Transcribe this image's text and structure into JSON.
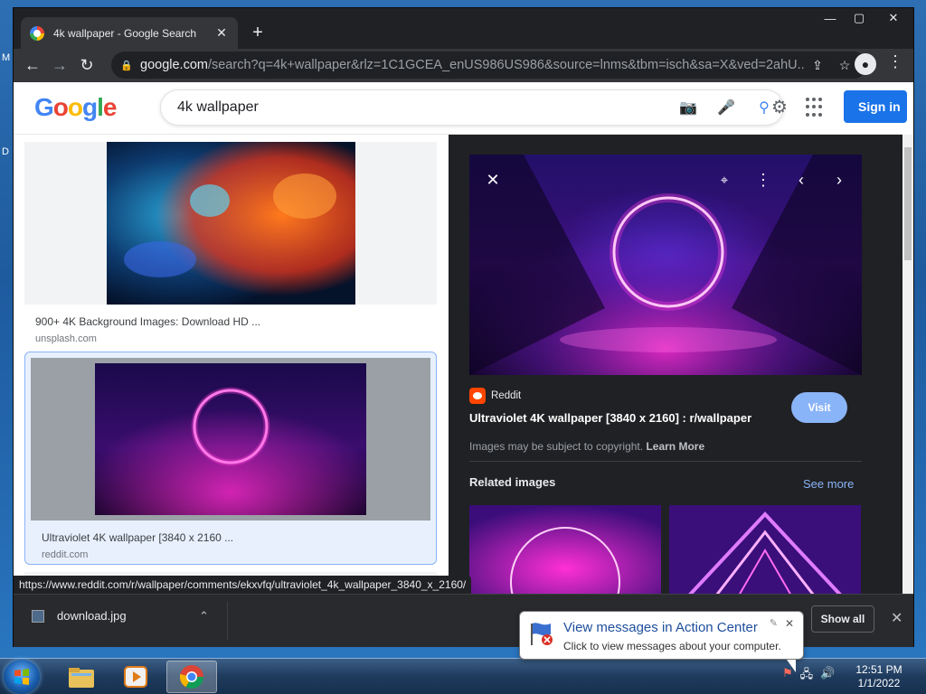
{
  "desktop": {
    "label1": "M",
    "label2": "D"
  },
  "window": {
    "minimize": "—",
    "maximize": "▢",
    "close": "✕"
  },
  "tab": {
    "title": "4k wallpaper - Google Search",
    "close": "✕",
    "new_tab": "+"
  },
  "toolbar": {
    "back": "←",
    "forward": "→",
    "reload": "↻",
    "url_host": "google.com",
    "url_path": "/search?q=4k+wallpaper&rlz=1C1GCEA_enUS986US986&source=lnms&tbm=isch&sa=X&ved=2ahU..."
  },
  "google": {
    "logo_letters": [
      "G",
      "o",
      "o",
      "g",
      "l",
      "e"
    ],
    "logo_colors": [
      "#4285f4",
      "#ea4335",
      "#fbbc05",
      "#4285f4",
      "#34a853",
      "#ea4335"
    ],
    "search_value": "4k wallpaper",
    "sign_in": "Sign in"
  },
  "results": [
    {
      "caption": "900+ 4K Background Images: Download HD ...",
      "source": "unsplash.com"
    },
    {
      "caption": "Ultraviolet 4K wallpaper [3840 x 2160 ...",
      "source": "reddit.com"
    }
  ],
  "panel": {
    "site": "Reddit",
    "title": "Ultraviolet 4K wallpaper [3840 x 2160] : r/wallpaper",
    "visit": "Visit",
    "copyright": "Images may be subject to copyright. ",
    "learn_more": "Learn More",
    "related": "Related images",
    "see_more": "See more"
  },
  "status_url": "https://www.reddit.com/r/wallpaper/comments/ekxvfq/ultraviolet_4k_wallpaper_3840_x_2160/",
  "downloads": {
    "file": "download.jpg",
    "show_all": "Show all",
    "chevron": "⌃",
    "close": "✕"
  },
  "balloon": {
    "title": "View messages in Action Center",
    "subtitle": "Click to view messages about your computer.",
    "close": "✕"
  },
  "taskbar": {
    "time": "12:51 PM",
    "date": "1/1/2022"
  },
  "colors": {
    "accent": "#1a73e8",
    "visit": "#8ab4f8",
    "reddit": "#ff4500"
  }
}
